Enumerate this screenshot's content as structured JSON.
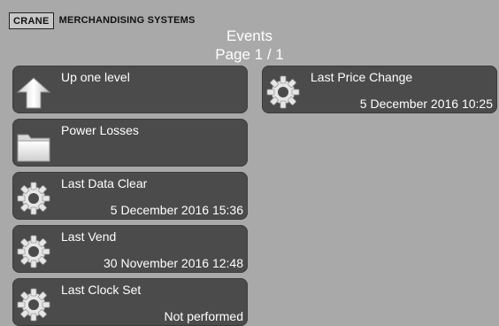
{
  "header": {
    "logo_brand": "CRANE",
    "logo_subtitle": "MERCHANDISING SYSTEMS",
    "title": "Events",
    "page": "Page 1 / 1"
  },
  "tiles": [
    {
      "label": "Up one level",
      "value": "",
      "icon": "up-arrow-icon"
    },
    {
      "label": "Power Losses",
      "value": "",
      "icon": "folder-icon"
    },
    {
      "label": "Last Data Clear",
      "value": "5 December 2016 15:36",
      "icon": "gear-icon"
    },
    {
      "label": "Last Vend",
      "value": "30 November 2016 12:48",
      "icon": "gear-icon"
    },
    {
      "label": "Last Clock Set",
      "value": "Not performed",
      "icon": "gear-icon"
    },
    {
      "label": "Last Price Change",
      "value": "5 December 2016 10:25",
      "icon": "gear-icon"
    }
  ],
  "colors": {
    "background": "#a9a9a9",
    "tile": "#4b4b4b",
    "text": "#ffffff"
  }
}
